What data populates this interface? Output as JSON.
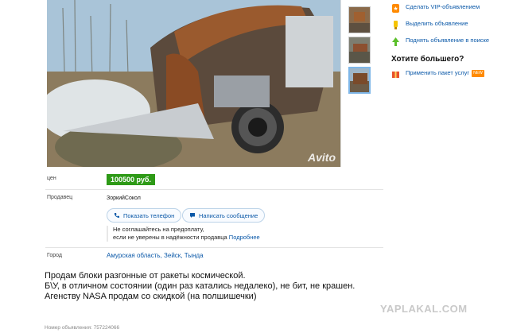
{
  "photo": {
    "watermark": "Avito"
  },
  "thumbnails": [
    "thumb-1",
    "thumb-2",
    "thumb-3"
  ],
  "sidebar": {
    "items": [
      {
        "label": "Сделать VIP-объявлением",
        "icon": "vip-star-icon"
      },
      {
        "label": "Выделить объявление",
        "icon": "highlight-icon"
      },
      {
        "label": "Поднять объявление в поиске",
        "icon": "raise-arrow-icon"
      }
    ],
    "heading": "Хотите большего?",
    "package": {
      "label": "Применить пакет услуг",
      "badge": "NEW",
      "icon": "package-icon"
    }
  },
  "price": {
    "label": "цен",
    "value": "100500 руб."
  },
  "seller": {
    "label": "Продавец",
    "name": "ЗоркийСокол",
    "show_phone": "Показать телефон",
    "write_message": "Написать сообщение",
    "warning_line1": "Не соглашайтесь на предоплату,",
    "warning_line2": "если не уверены в надёжности продавца",
    "more_link": "Подробнее"
  },
  "city": {
    "label": "Город",
    "value": "Амурская область, Зейск, Тында"
  },
  "description": [
    "Продам блоки разгонные от ракеты космической.",
    "Б\\У, в отличном состоянии (один раз катались недалеко), не бит, не крашен.",
    "Агенству NASA продам со скидкой (на полшишечки)"
  ],
  "ad_number": "Номер объявления: 757224066",
  "site_watermark": "YAPLAKAL.COM",
  "colors": {
    "link": "#0a58a8",
    "price_bg": "#2e9a17",
    "accent_orange": "#ff8a00"
  }
}
